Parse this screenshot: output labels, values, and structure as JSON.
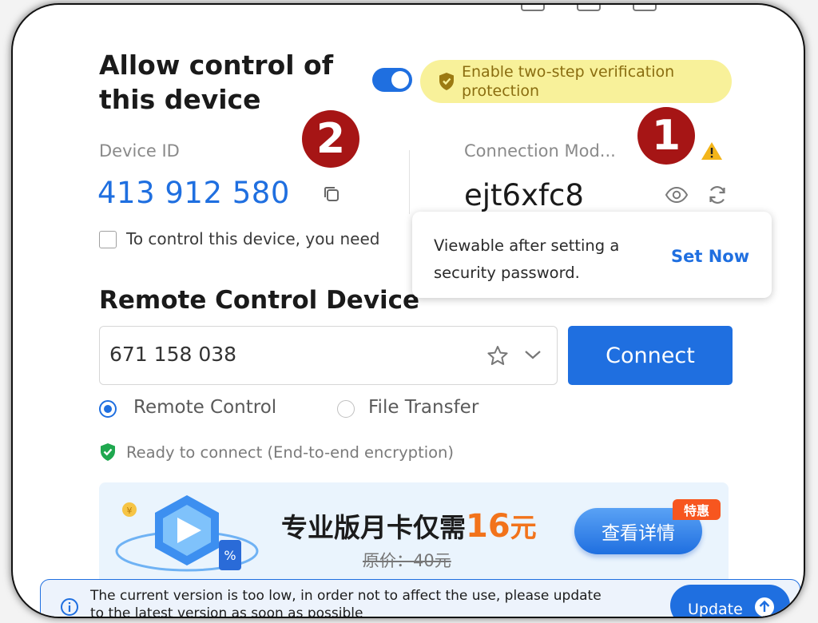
{
  "header": {
    "title_line1": "Allow control of",
    "title_line2": "this device",
    "toggle_on": true,
    "two_step_banner": "Enable two-step verification protection"
  },
  "annotations": {
    "badge1": "1",
    "badge2": "2"
  },
  "device": {
    "id_label": "Device ID",
    "id_value": "413 912 580",
    "connection_label": "Connection Mod...",
    "password_value": "ejt6xfc8",
    "checkbox_label": "To control this device, you need"
  },
  "tooltip": {
    "text": "Viewable after setting a security password.",
    "link": "Set Now"
  },
  "remote": {
    "section_title": "Remote Control Device",
    "input_value": "671 158 038",
    "connect_label": "Connect",
    "mode_options": [
      "Remote Control",
      "File Transfer"
    ],
    "selected_mode": "Remote Control",
    "status_text": "Ready to connect (End-to-end encryption)"
  },
  "promo": {
    "main_text": "专业版月卡仅需",
    "price": "16",
    "unit": "元",
    "original_price": "原价：40元",
    "button_label": "查看详情",
    "tag": "特惠"
  },
  "update_bar": {
    "text": "The current version is too low, in order not to affect the use, please update to the latest version as soon as possible",
    "button_label": "Update"
  },
  "colors": {
    "accent": "#1f6fe0",
    "badge": "#a61515",
    "banner_bg": "#f8f19a",
    "promo_price": "#f2731b"
  }
}
